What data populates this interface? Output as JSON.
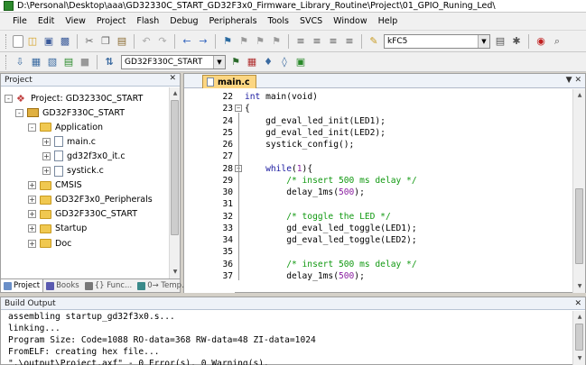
{
  "window": {
    "title": "D:\\Personal\\Desktop\\aaa\\GD32330C_START_GD32F3x0_Firmware_Library_Routine\\Project\\01_GPIO_Runing_Led\\"
  },
  "menu": [
    "File",
    "Edit",
    "View",
    "Project",
    "Flash",
    "Debug",
    "Peripherals",
    "Tools",
    "SVCS",
    "Window",
    "Help"
  ],
  "toolbar": {
    "find_value": "kFC5",
    "target_value": "GD32F330C_START"
  },
  "project_panel": {
    "title": "Project",
    "tree": [
      {
        "label": "Project: GD32330C_START",
        "level": 0,
        "kind": "root",
        "expander": "-"
      },
      {
        "label": "GD32F330C_START",
        "level": 1,
        "kind": "target",
        "expander": "-"
      },
      {
        "label": "Application",
        "level": 2,
        "kind": "folder",
        "expander": "-"
      },
      {
        "label": "main.c",
        "level": 3,
        "kind": "file",
        "expander": "+"
      },
      {
        "label": "gd32f3x0_it.c",
        "level": 3,
        "kind": "file",
        "expander": "+"
      },
      {
        "label": "systick.c",
        "level": 3,
        "kind": "file",
        "expander": "+"
      },
      {
        "label": "CMSIS",
        "level": 2,
        "kind": "folder",
        "expander": "+"
      },
      {
        "label": "GD32F3x0_Peripherals",
        "level": 2,
        "kind": "folder",
        "expander": "+"
      },
      {
        "label": "GD32F330C_START",
        "level": 2,
        "kind": "folder",
        "expander": "+"
      },
      {
        "label": "Startup",
        "level": 2,
        "kind": "folder",
        "expander": "+"
      },
      {
        "label": "Doc",
        "level": 2,
        "kind": "folder",
        "expander": "+"
      }
    ],
    "tabs": [
      "Project",
      "Books",
      "{} Func...",
      "0→ Temp..."
    ]
  },
  "editor": {
    "tab": "main.c",
    "lines": [
      {
        "n": "22",
        "parts": [
          [
            "kw",
            "int "
          ],
          [
            "",
            "main(void)"
          ]
        ]
      },
      {
        "n": "23",
        "fold": "-",
        "parts": [
          [
            "",
            "{"
          ]
        ]
      },
      {
        "n": "24",
        "parts": [
          [
            "",
            "    gd_eval_led_init(LED1);"
          ]
        ]
      },
      {
        "n": "25",
        "parts": [
          [
            "",
            "    gd_eval_led_init(LED2);"
          ]
        ]
      },
      {
        "n": "26",
        "parts": [
          [
            "",
            "    systick_config();"
          ]
        ]
      },
      {
        "n": "27",
        "parts": [
          [
            "",
            ""
          ]
        ]
      },
      {
        "n": "28",
        "fold": "-",
        "parts": [
          [
            "kw",
            "    while"
          ],
          [
            "",
            "("
          ],
          [
            "nm",
            "1"
          ],
          [
            "",
            ")"
          ],
          [
            "",
            "{"
          ]
        ]
      },
      {
        "n": "29",
        "parts": [
          [
            "cm",
            "        /* insert 500 ms delay */"
          ]
        ]
      },
      {
        "n": "30",
        "parts": [
          [
            "",
            "        delay_1ms("
          ],
          [
            "nm",
            "500"
          ],
          [
            "",
            ");"
          ]
        ]
      },
      {
        "n": "31",
        "parts": [
          [
            "",
            ""
          ]
        ]
      },
      {
        "n": "32",
        "parts": [
          [
            "cm",
            "        /* toggle the LED */"
          ]
        ]
      },
      {
        "n": "33",
        "parts": [
          [
            "",
            "        gd_eval_led_toggle(LED1);"
          ]
        ]
      },
      {
        "n": "34",
        "parts": [
          [
            "",
            "        gd_eval_led_toggle(LED2);"
          ]
        ]
      },
      {
        "n": "35",
        "parts": [
          [
            "",
            ""
          ]
        ]
      },
      {
        "n": "36",
        "parts": [
          [
            "cm",
            "        /* insert 500 ms delay */"
          ]
        ]
      },
      {
        "n": "37",
        "parts": [
          [
            "",
            "        delay_1ms("
          ],
          [
            "nm",
            "500"
          ],
          [
            "",
            ");"
          ]
        ]
      }
    ]
  },
  "build_output": {
    "title": "Build Output",
    "lines": [
      "assembling startup_gd32f3x0.s...",
      "linking...",
      "Program Size: Code=1088 RO-data=368 RW-data=48 ZI-data=1024",
      "FromELF: creating hex file...",
      "\".\\output\\Project.axf\" - 0 Error(s), 0 Warning(s)."
    ]
  },
  "colors": {
    "keyword": "#1a1aa0",
    "comment": "#119911",
    "number": "#8a1ea0",
    "active_tab": "#fcd682"
  }
}
